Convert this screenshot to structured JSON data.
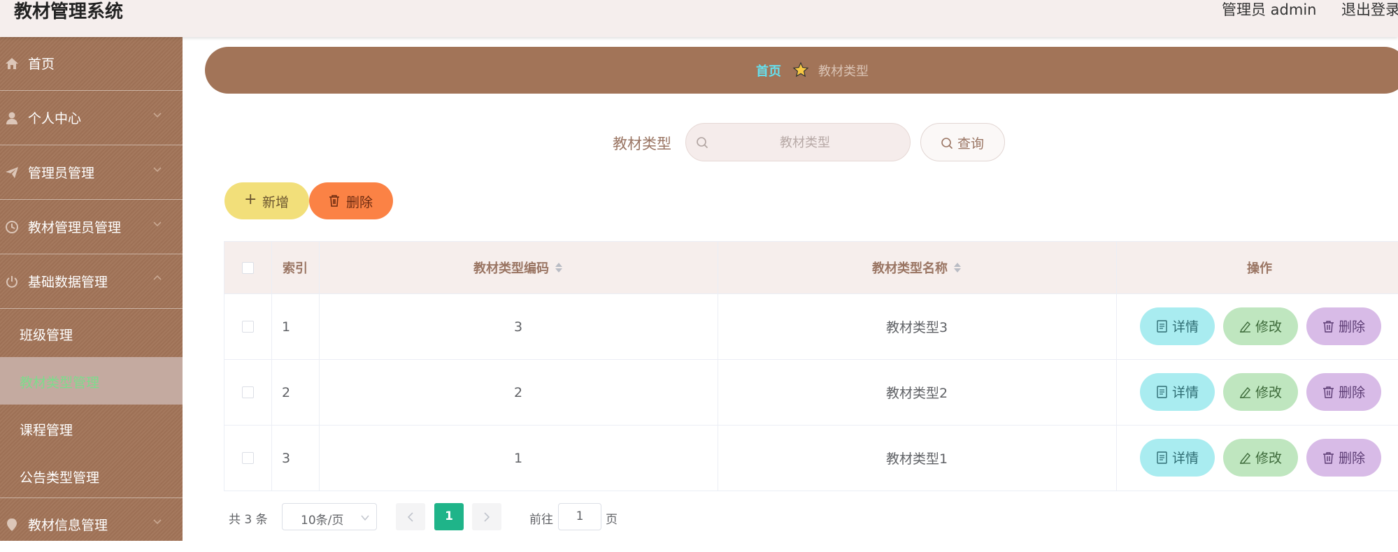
{
  "header": {
    "app_title": "教材管理系统",
    "user_label": "管理员 admin",
    "logout_label": "退出登录"
  },
  "sidebar": {
    "items": [
      {
        "label": "首页",
        "icon": "home-icon"
      },
      {
        "label": "个人中心",
        "icon": "user-icon"
      },
      {
        "label": "管理员管理",
        "icon": "paper-plane-icon"
      },
      {
        "label": "教材管理员管理",
        "icon": "clock-icon"
      },
      {
        "label": "基础数据管理",
        "icon": "power-icon"
      },
      {
        "label": "教材信息管理",
        "icon": "location-icon"
      }
    ],
    "submenu": [
      {
        "label": "班级管理"
      },
      {
        "label": "教材类型管理"
      },
      {
        "label": "课程管理"
      },
      {
        "label": "公告类型管理"
      }
    ]
  },
  "breadcrumb": {
    "home": "首页",
    "current": "教材类型"
  },
  "search": {
    "label": "教材类型",
    "placeholder": "教材类型",
    "button": "查询"
  },
  "toolbar": {
    "add": "新增",
    "delete": "删除"
  },
  "table": {
    "columns": [
      "索引",
      "教材类型编码",
      "教材类型名称",
      "操作"
    ],
    "rows": [
      {
        "index": "1",
        "code": "3",
        "name": "教材类型3"
      },
      {
        "index": "2",
        "code": "2",
        "name": "教材类型2"
      },
      {
        "index": "3",
        "code": "1",
        "name": "教材类型1"
      }
    ],
    "actions": {
      "detail": "详情",
      "edit": "修改",
      "delete": "删除"
    }
  },
  "pagination": {
    "total": "共 3 条",
    "page_size": "10条/页",
    "current_page": "1",
    "goto_label": "前往",
    "goto_value": "1",
    "page_suffix": "页"
  },
  "colors": {
    "sidebar_bg": "#a27458",
    "active_text": "#7ddc8c",
    "breadcrumb_home": "#66e0ee",
    "primary": "#1fb489"
  }
}
